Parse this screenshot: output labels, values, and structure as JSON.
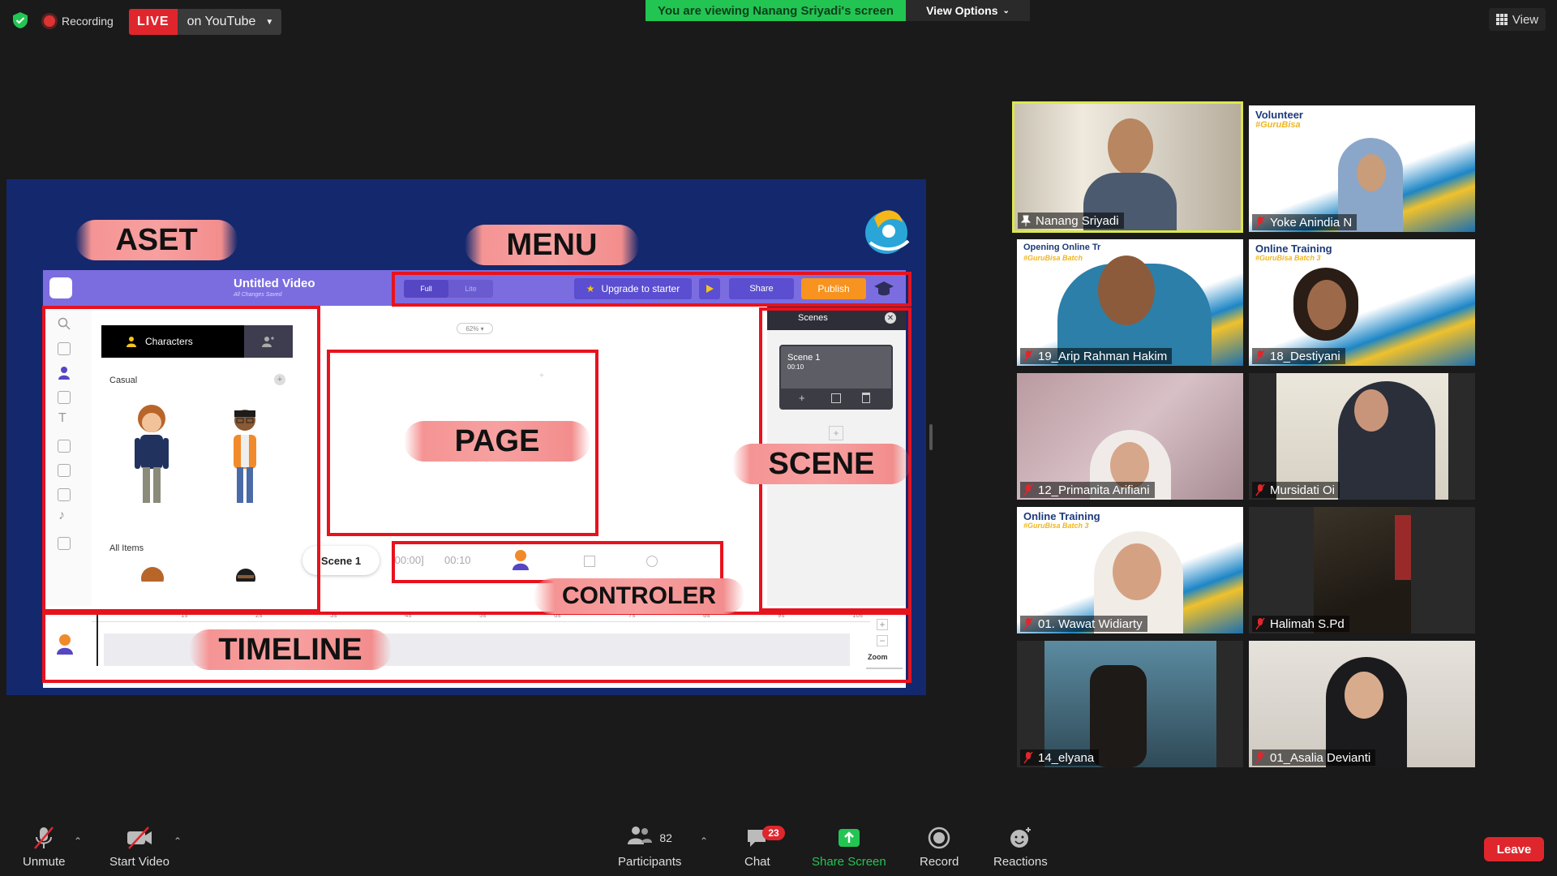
{
  "topbar": {
    "recording_label": "Recording",
    "live_badge": "LIVE",
    "live_destination": "on YouTube",
    "viewing_banner": "You are viewing Nanang Sriyadi's screen",
    "view_options": "View Options",
    "view_button": "View"
  },
  "shared_screen": {
    "app_title": "Untitled Video",
    "app_subtitle": "All Changes Saved",
    "mode_full": "Full",
    "mode_lite": "Lite",
    "upgrade": "Upgrade to starter",
    "share": "Share",
    "publish": "Publish",
    "characters_tab": "Characters",
    "casual_label": "Casual",
    "all_items_label": "All Items",
    "zoom_percent": "62%",
    "scenes_header": "Scenes",
    "scene_card_title": "Scene 1",
    "scene_card_time": "00:10",
    "scene_pill": "Scene 1",
    "ctrl_time_start": "[00:00]",
    "ctrl_time_end": "00:10",
    "zoom_label": "Zoom",
    "ruler": [
      "1s",
      "2s",
      "3s",
      "4s",
      "5s",
      "6s",
      "7s",
      "8s",
      "9s",
      "10s"
    ],
    "annotations": {
      "aset": "ASET",
      "menu": "MENU",
      "page": "PAGE",
      "scene": "SCENE",
      "controler": "CONTROLER",
      "timeline": "TIMELINE"
    }
  },
  "participants": [
    {
      "name": "Nanang Sriyadi",
      "active": true
    },
    {
      "name": "Yoke Anindia N",
      "banner1": "Volunteer",
      "banner2": "#GuruBisa"
    },
    {
      "name": "19_Arip Rahman Hakim",
      "banner1": "Opening Online Tr",
      "banner2": "#GuruBisa Batch"
    },
    {
      "name": "18_Destiyani",
      "banner1": "Online Training",
      "banner2": "#GuruBisa Batch 3"
    },
    {
      "name": "12_Primanita Arifiani"
    },
    {
      "name": "Mursidati Oi"
    },
    {
      "name": "01. Wawat Widiarty",
      "banner1": "Online Training",
      "banner2": "#GuruBisa Batch 3"
    },
    {
      "name": "Halimah S.Pd"
    },
    {
      "name": "14_elyana"
    },
    {
      "name": "01_Asalia Devianti"
    }
  ],
  "toolbar": {
    "unmute": "Unmute",
    "start_video": "Start Video",
    "participants": "Participants",
    "participants_count": "82",
    "chat": "Chat",
    "chat_badge": "23",
    "share_screen": "Share Screen",
    "record": "Record",
    "reactions": "Reactions",
    "leave": "Leave"
  },
  "colors": {
    "live_red": "#e0262d",
    "viewing_green": "#23c552",
    "share_screen_green": "#23c552",
    "active_speaker": "#dce84a",
    "annotation_red": "#e8121d",
    "app_purple": "#7b6de0",
    "publish_orange": "#f7931e"
  }
}
